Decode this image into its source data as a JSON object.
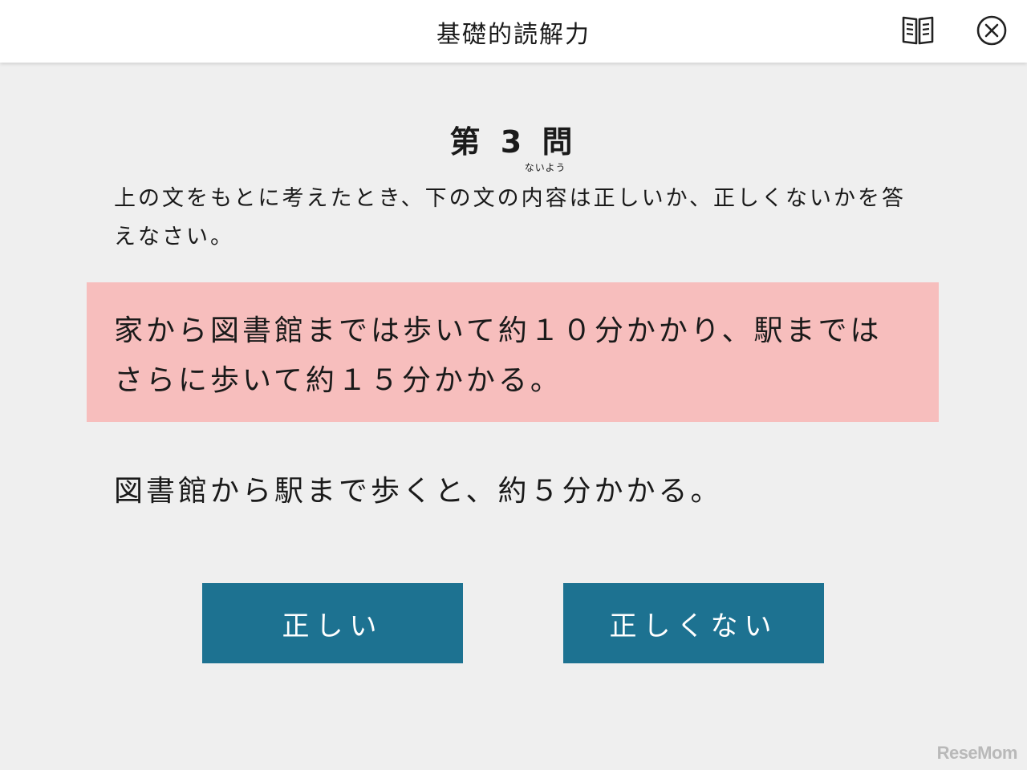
{
  "header": {
    "title": "基礎的読解力",
    "icons": {
      "reading": "book-icon",
      "close": "close-circle-icon"
    }
  },
  "question": {
    "number_label": "第 3 問",
    "prompt_before": "上の文をもとに考えたとき、下の文の",
    "prompt_ruby_base": "内容",
    "prompt_ruby_text": "ないよう",
    "prompt_after": "は正しいか、正しくないかを答えなさい。"
  },
  "passage": {
    "text_line1": "家から図書館までは歩いて約１０分かかり、駅までは",
    "text_line2": "さらに歩いて約１５分かかる。",
    "background_color": "#f7bebd"
  },
  "statement": {
    "text": "図書館から駅まで歩くと、約５分かかる。"
  },
  "answers": {
    "true_label": "正しい",
    "false_label": "正しくない",
    "button_color": "#1d7291"
  },
  "watermark": {
    "text": "ReseMom"
  }
}
